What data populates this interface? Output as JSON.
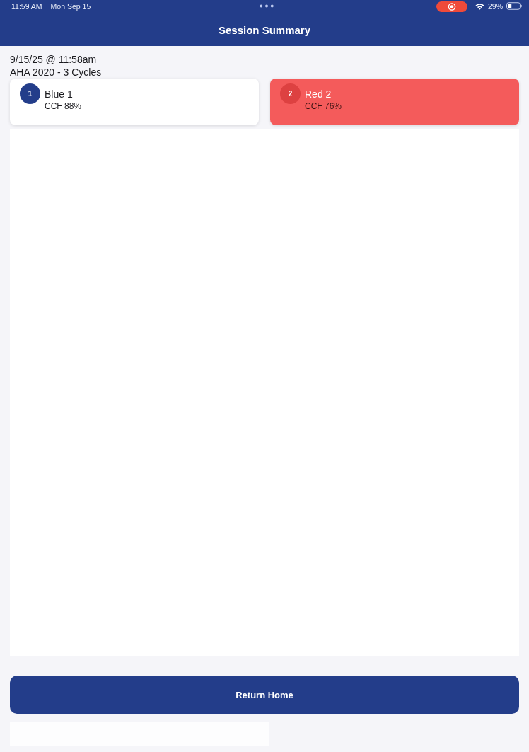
{
  "status_bar": {
    "time": "11:59 AM",
    "date": "Mon Sep 15",
    "battery": "29%"
  },
  "nav_bar": {
    "title": "Session Summary"
  },
  "session": {
    "datetime": "9/15/25 @ 11:58am",
    "protocol": "AHA 2020 - 3 Cycles"
  },
  "participants": [
    {
      "number": "1",
      "name": "Blue 1",
      "ccf": "CCF 88%",
      "color": "#233d8a",
      "selected": false
    },
    {
      "number": "2",
      "name": "Red 2",
      "ccf": "CCF 76%",
      "color": "#dd4141",
      "selected": true
    }
  ],
  "buttons": [
    {
      "label": "Return Home"
    }
  ]
}
